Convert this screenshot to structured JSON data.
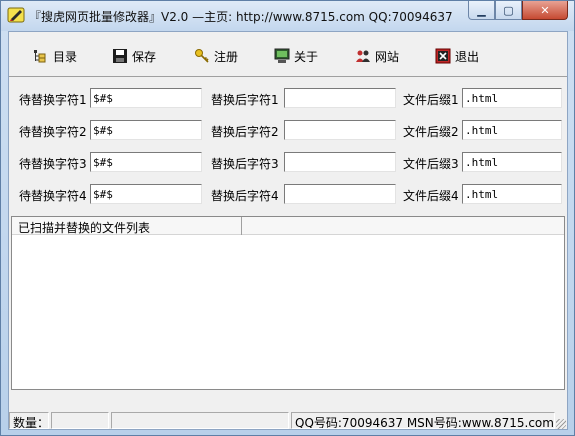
{
  "window": {
    "title": "『搜虎网页批量修改器』V2.0 —主页: http://www.8715.com QQ:70094637",
    "icon": "pencil-icon"
  },
  "toolbar": {
    "items": [
      {
        "label": "目录",
        "icon": "folder-tree-icon"
      },
      {
        "label": "保存",
        "icon": "floppy-disk-icon"
      },
      {
        "label": "注册",
        "icon": "key-icon"
      },
      {
        "label": "关于",
        "icon": "computer-icon"
      },
      {
        "label": "网站",
        "icon": "people-icon"
      },
      {
        "label": "退出",
        "icon": "exit-icon"
      }
    ]
  },
  "rows": [
    {
      "find_label": "待替换字符1",
      "find_value": "$#$",
      "replace_label": "替换后字符1",
      "replace_value": "",
      "ext_label": "文件后缀1",
      "ext_value": ".html"
    },
    {
      "find_label": "待替换字符2",
      "find_value": "$#$",
      "replace_label": "替换后字符2",
      "replace_value": "",
      "ext_label": "文件后缀2",
      "ext_value": ".html"
    },
    {
      "find_label": "待替换字符3",
      "find_value": "$#$",
      "replace_label": "替换后字符3",
      "replace_value": "",
      "ext_label": "文件后缀3",
      "ext_value": ".html"
    },
    {
      "find_label": "待替换字符4",
      "find_value": "$#$",
      "replace_label": "替换后字符4",
      "replace_value": "",
      "ext_label": "文件后缀4",
      "ext_value": ".html"
    }
  ],
  "filelist": {
    "header": "已扫描并替换的文件列表"
  },
  "statusbar": {
    "count_label": "数量：",
    "contact": "QQ号码:70094637 MSN号码:www.8715.com@"
  }
}
